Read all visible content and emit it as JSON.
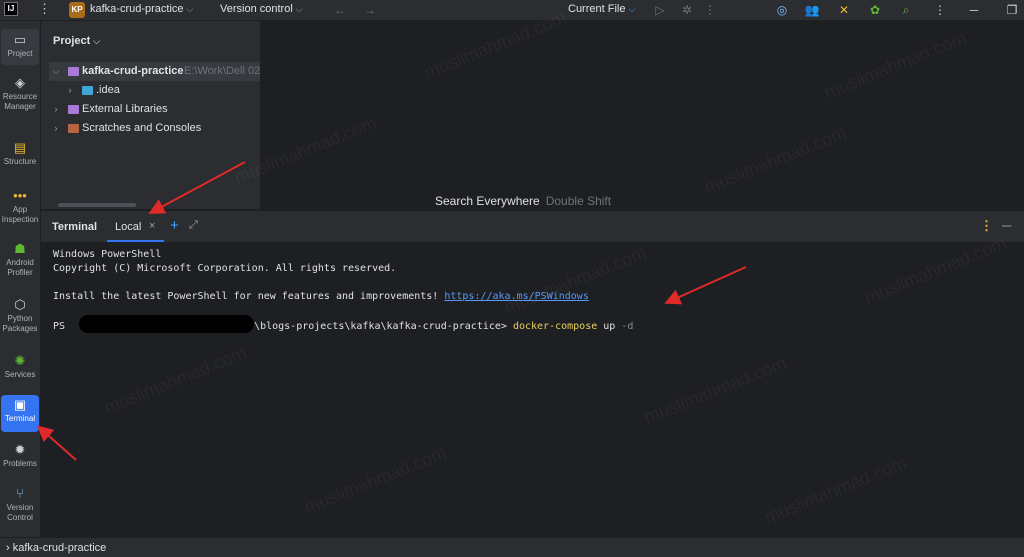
{
  "topbar": {
    "app_logo": "IJ",
    "menu_icon": "more-vert-icon",
    "project_badge": "KP",
    "project_name": "kafka-crud-practice",
    "version_control": "Version control",
    "run_config": "Current File"
  },
  "tool_window_bar": {
    "items": [
      {
        "label": "Project",
        "icon": "laptop-icon"
      },
      {
        "label": "Resource Manager",
        "icon": "resource-icon"
      },
      {
        "label": "Structure",
        "icon": "structure-icon"
      },
      {
        "label": "App Inspection",
        "icon": "app-inspection-icon"
      },
      {
        "label": "Android Profiler",
        "icon": "android-icon"
      },
      {
        "label": "Python Packages",
        "icon": "python-packages-icon"
      },
      {
        "label": "Services",
        "icon": "services-icon"
      },
      {
        "label": "Terminal",
        "icon": "terminal-icon"
      },
      {
        "label": "Problems",
        "icon": "problems-icon"
      },
      {
        "label": "Version Control",
        "icon": "vcs-icon"
      }
    ]
  },
  "project_panel": {
    "title": "Project",
    "tree": [
      {
        "label": "kafka-crud-practice",
        "hint": "E:\\Work\\Dell 02"
      },
      {
        "label": ".idea"
      },
      {
        "label": "External Libraries"
      },
      {
        "label": "Scratches and Consoles"
      }
    ]
  },
  "editor": {
    "search_hint": "Search Everywhere",
    "search_shortcut": "Double Shift"
  },
  "terminal": {
    "title": "Terminal",
    "tab_label": "Local",
    "lines": {
      "l1": "Windows PowerShell",
      "l2": "Copyright (C) Microsoft Corporation. All rights reserved.",
      "l3": "Install the latest PowerShell for new features and improvements! ",
      "l3_link": "https://aka.ms/PSWindows",
      "prompt_prefix": "PS ",
      "prompt_path": "\\blogs-projects\\kafka\\kafka-crud-practice> ",
      "cmd": "docker-compose",
      "cmd_arg": " up ",
      "cmd_flag": "-d"
    }
  },
  "statusbar": {
    "project": "kafka-crud-practice"
  },
  "watermark": "muslimahmad.com",
  "colors": {
    "accent": "#3574f0",
    "annotation_arrow": "#e02a2a",
    "command": "#e7d15c",
    "link": "#5899f6"
  }
}
